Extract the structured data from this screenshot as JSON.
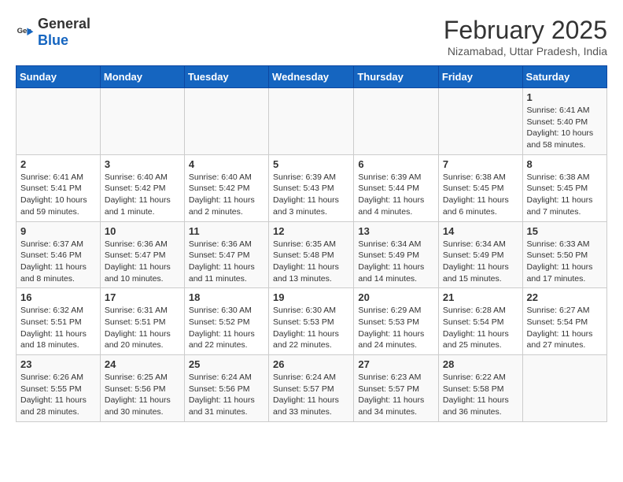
{
  "header": {
    "logo": {
      "general": "General",
      "blue": "Blue"
    },
    "title": "February 2025",
    "location": "Nizamabad, Uttar Pradesh, India"
  },
  "calendar": {
    "headers": [
      "Sunday",
      "Monday",
      "Tuesday",
      "Wednesday",
      "Thursday",
      "Friday",
      "Saturday"
    ],
    "weeks": [
      [
        {
          "day": "",
          "info": ""
        },
        {
          "day": "",
          "info": ""
        },
        {
          "day": "",
          "info": ""
        },
        {
          "day": "",
          "info": ""
        },
        {
          "day": "",
          "info": ""
        },
        {
          "day": "",
          "info": ""
        },
        {
          "day": "1",
          "info": "Sunrise: 6:41 AM\nSunset: 5:40 PM\nDaylight: 10 hours and 58 minutes."
        }
      ],
      [
        {
          "day": "2",
          "info": "Sunrise: 6:41 AM\nSunset: 5:41 PM\nDaylight: 10 hours and 59 minutes."
        },
        {
          "day": "3",
          "info": "Sunrise: 6:40 AM\nSunset: 5:42 PM\nDaylight: 11 hours and 1 minute."
        },
        {
          "day": "4",
          "info": "Sunrise: 6:40 AM\nSunset: 5:42 PM\nDaylight: 11 hours and 2 minutes."
        },
        {
          "day": "5",
          "info": "Sunrise: 6:39 AM\nSunset: 5:43 PM\nDaylight: 11 hours and 3 minutes."
        },
        {
          "day": "6",
          "info": "Sunrise: 6:39 AM\nSunset: 5:44 PM\nDaylight: 11 hours and 4 minutes."
        },
        {
          "day": "7",
          "info": "Sunrise: 6:38 AM\nSunset: 5:45 PM\nDaylight: 11 hours and 6 minutes."
        },
        {
          "day": "8",
          "info": "Sunrise: 6:38 AM\nSunset: 5:45 PM\nDaylight: 11 hours and 7 minutes."
        }
      ],
      [
        {
          "day": "9",
          "info": "Sunrise: 6:37 AM\nSunset: 5:46 PM\nDaylight: 11 hours and 8 minutes."
        },
        {
          "day": "10",
          "info": "Sunrise: 6:36 AM\nSunset: 5:47 PM\nDaylight: 11 hours and 10 minutes."
        },
        {
          "day": "11",
          "info": "Sunrise: 6:36 AM\nSunset: 5:47 PM\nDaylight: 11 hours and 11 minutes."
        },
        {
          "day": "12",
          "info": "Sunrise: 6:35 AM\nSunset: 5:48 PM\nDaylight: 11 hours and 13 minutes."
        },
        {
          "day": "13",
          "info": "Sunrise: 6:34 AM\nSunset: 5:49 PM\nDaylight: 11 hours and 14 minutes."
        },
        {
          "day": "14",
          "info": "Sunrise: 6:34 AM\nSunset: 5:49 PM\nDaylight: 11 hours and 15 minutes."
        },
        {
          "day": "15",
          "info": "Sunrise: 6:33 AM\nSunset: 5:50 PM\nDaylight: 11 hours and 17 minutes."
        }
      ],
      [
        {
          "day": "16",
          "info": "Sunrise: 6:32 AM\nSunset: 5:51 PM\nDaylight: 11 hours and 18 minutes."
        },
        {
          "day": "17",
          "info": "Sunrise: 6:31 AM\nSunset: 5:51 PM\nDaylight: 11 hours and 20 minutes."
        },
        {
          "day": "18",
          "info": "Sunrise: 6:30 AM\nSunset: 5:52 PM\nDaylight: 11 hours and 22 minutes."
        },
        {
          "day": "19",
          "info": "Sunrise: 6:30 AM\nSunset: 5:53 PM\nDaylight: 11 hours and 22 minutes."
        },
        {
          "day": "20",
          "info": "Sunrise: 6:29 AM\nSunset: 5:53 PM\nDaylight: 11 hours and 24 minutes."
        },
        {
          "day": "21",
          "info": "Sunrise: 6:28 AM\nSunset: 5:54 PM\nDaylight: 11 hours and 25 minutes."
        },
        {
          "day": "22",
          "info": "Sunrise: 6:27 AM\nSunset: 5:54 PM\nDaylight: 11 hours and 27 minutes."
        }
      ],
      [
        {
          "day": "23",
          "info": "Sunrise: 6:26 AM\nSunset: 5:55 PM\nDaylight: 11 hours and 28 minutes."
        },
        {
          "day": "24",
          "info": "Sunrise: 6:25 AM\nSunset: 5:56 PM\nDaylight: 11 hours and 30 minutes."
        },
        {
          "day": "25",
          "info": "Sunrise: 6:24 AM\nSunset: 5:56 PM\nDaylight: 11 hours and 31 minutes."
        },
        {
          "day": "26",
          "info": "Sunrise: 6:24 AM\nSunset: 5:57 PM\nDaylight: 11 hours and 33 minutes."
        },
        {
          "day": "27",
          "info": "Sunrise: 6:23 AM\nSunset: 5:57 PM\nDaylight: 11 hours and 34 minutes."
        },
        {
          "day": "28",
          "info": "Sunrise: 6:22 AM\nSunset: 5:58 PM\nDaylight: 11 hours and 36 minutes."
        },
        {
          "day": "",
          "info": ""
        }
      ]
    ]
  }
}
